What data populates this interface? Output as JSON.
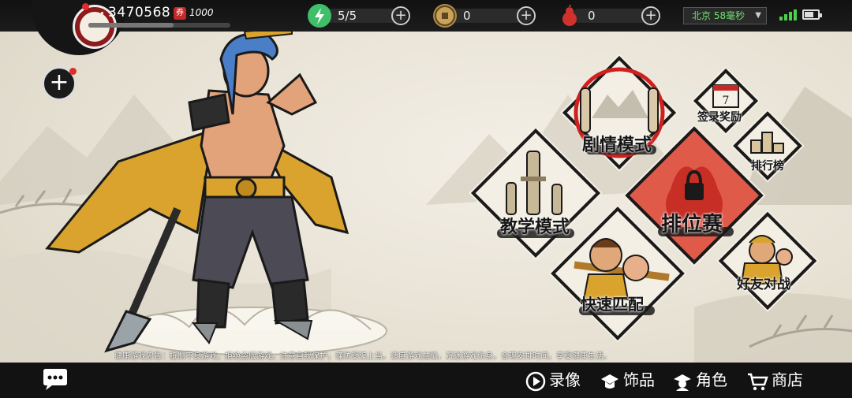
{
  "player": {
    "coins": "3470568",
    "ticket_value": "1000",
    "xp_fraction": 0.6
  },
  "resources": [
    {
      "name": "energy",
      "icon": "lightning-icon",
      "value": "5/5",
      "color": "#3fbf6a"
    },
    {
      "name": "copper",
      "icon": "copper-coin-icon",
      "value": "0",
      "color": "#b08a4a"
    },
    {
      "name": "gourd",
      "icon": "gourd-icon",
      "value": "0",
      "color": "#d0312d"
    }
  ],
  "status": {
    "server": "北京 58毫秒",
    "signal_color": "#4ccf4c"
  },
  "modes": {
    "story": "剧情模式",
    "login_reward": "签录奖励",
    "ranking": "排行榜",
    "tutorial": "教学模式",
    "ranked": "排位赛",
    "quick_match": "快速匹配",
    "friend_battle": "好友对战"
  },
  "notice": "健康游戏忠告：抵制不良游戏，拒绝盗版游戏。注意自我保护，谨防受骗上当。适度游戏益脑，沉迷游戏伤身。合理安排时间，享受健康生活。",
  "bottom_nav": {
    "record": "录像",
    "accessory": "饰品",
    "character": "角色",
    "shop": "商店"
  },
  "colors": {
    "accent_red": "#c62828",
    "ink": "#1a1a1a",
    "paper": "#f4efe4"
  }
}
